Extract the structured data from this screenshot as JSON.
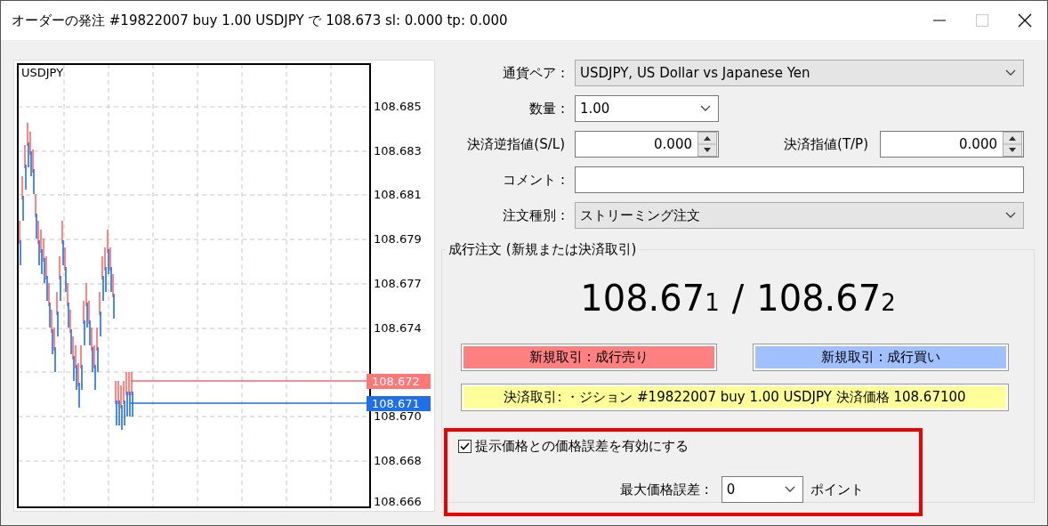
{
  "window": {
    "title": "オーダーの発注 #19822007 buy 1.00 USDJPY で 108.673 sl: 0.000 tp: 0.000"
  },
  "chart": {
    "symbol": "USDJPY",
    "price_axis": [
      "108.685",
      "108.683",
      "108.681",
      "108.679",
      "108.677",
      "108.674",
      "108.670",
      "108.668",
      "108.666"
    ],
    "ask_tag": "108.672",
    "bid_tag": "108.671"
  },
  "symbol": {
    "label": "通貨ペア :",
    "value": "USDJPY, US Dollar vs Japanese Yen"
  },
  "volume": {
    "label": "数量 :",
    "value": "1.00"
  },
  "stop_loss": {
    "label": "決済逆指値(S/L)",
    "value": "0.000"
  },
  "take_profit": {
    "label": "決済指値(T/P)",
    "value": "0.000"
  },
  "comment": {
    "label": "コメント :"
  },
  "order_type": {
    "label": "注文種別 :",
    "value": "ストリーミング注文"
  },
  "market_execution": {
    "title": "成行注文 (新規または決済取引)",
    "bid": {
      "main": "108.67",
      "pip": "1"
    },
    "separator": "/",
    "ask": {
      "main": "108.67",
      "pip": "2"
    },
    "sell_button": "新規取引 : 成行売り",
    "buy_button": "新規取引 : 成行買い",
    "close_button": "決済取引: ・ジション #19822007 buy 1.00 USDJPY 決済価格 108.67100",
    "deviation": {
      "label": "提示価格との価格誤差を有効にする",
      "checked": true
    },
    "max_deviation": {
      "label": "最大価格誤差 :",
      "value": "0",
      "unit": "ポイント"
    }
  }
}
